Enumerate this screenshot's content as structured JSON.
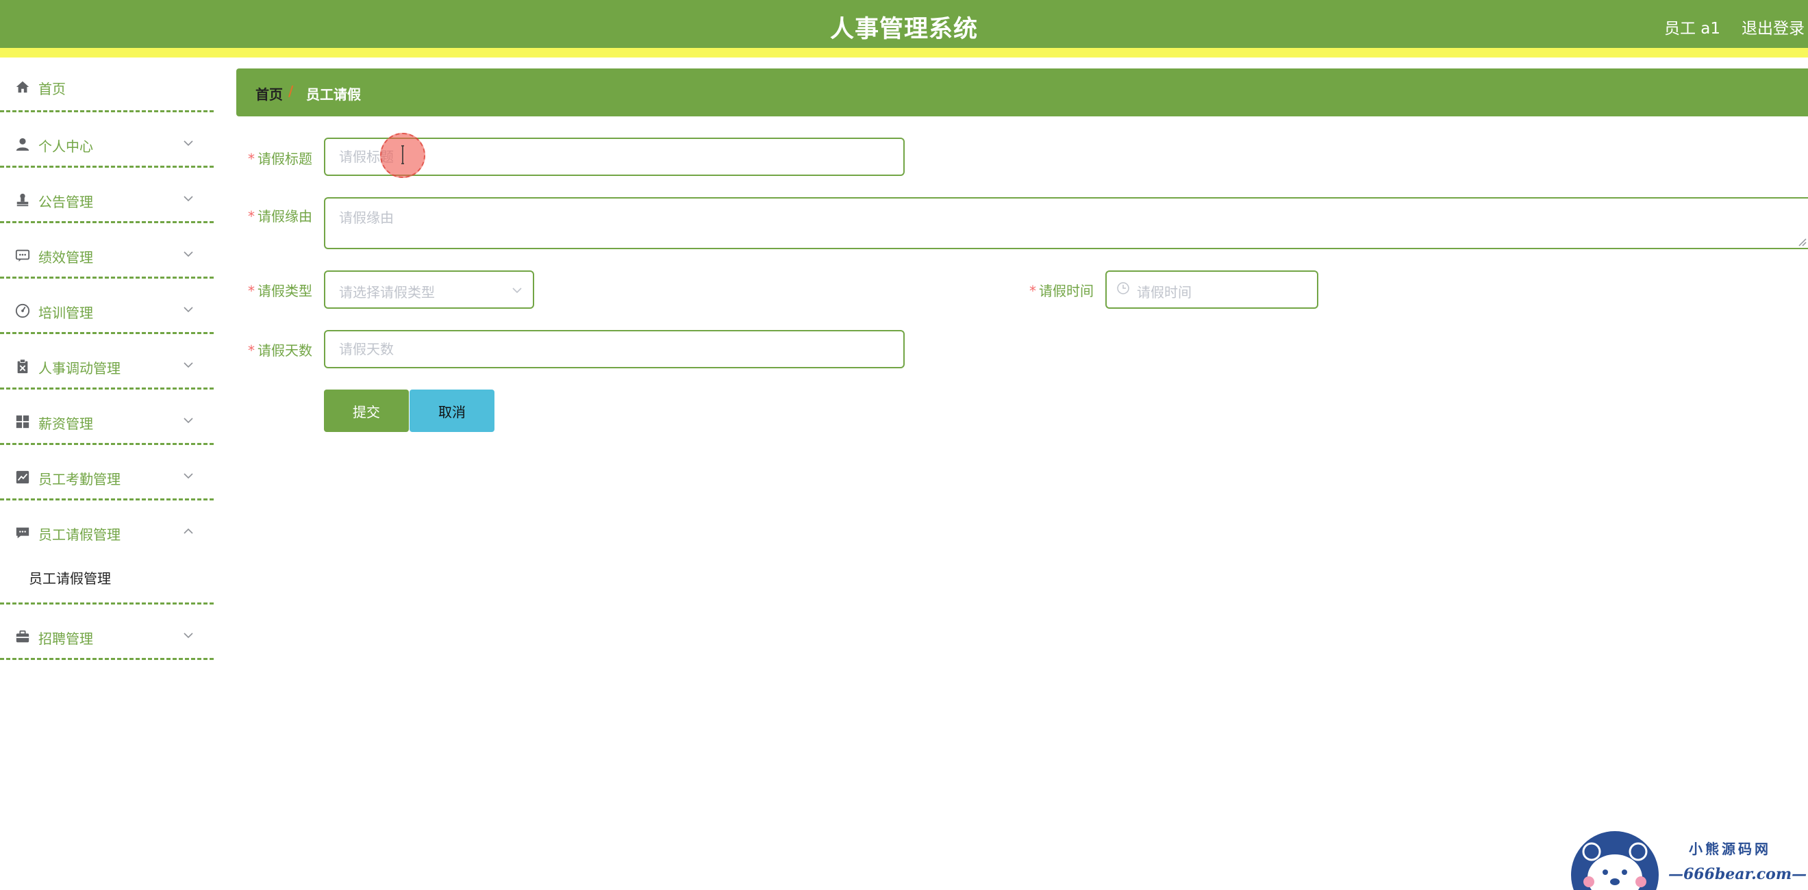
{
  "header": {
    "title": "人事管理系统",
    "user": "员工 a1",
    "logout": "退出登录"
  },
  "colors": {
    "primary": "#72a545",
    "header_stripe": "#f7f75a",
    "cancel_button": "#4fbedb",
    "required_mark": "#f56c6c"
  },
  "sidebar": {
    "items": [
      {
        "label": "首页",
        "icon": "home-icon"
      },
      {
        "label": "个人中心",
        "icon": "user-icon"
      },
      {
        "label": "公告管理",
        "icon": "stamp-icon"
      },
      {
        "label": "绩效管理",
        "icon": "chat-dots-icon"
      },
      {
        "label": "培训管理",
        "icon": "gauge-icon"
      },
      {
        "label": "人事调动管理",
        "icon": "clipboard-icon"
      },
      {
        "label": "薪资管理",
        "icon": "grid-icon"
      },
      {
        "label": "员工考勤管理",
        "icon": "chart-line-icon"
      },
      {
        "label": "员工请假管理",
        "icon": "message-icon",
        "submenu": [
          "员工请假管理"
        ]
      },
      {
        "label": "招聘管理",
        "icon": "briefcase-icon"
      }
    ]
  },
  "breadcrumb": {
    "home": "首页",
    "separator": "/",
    "current": "员工请假"
  },
  "form": {
    "title": {
      "label": "请假标题",
      "placeholder": "请假标题",
      "value": ""
    },
    "reason": {
      "label": "请假缘由",
      "placeholder": "请假缘由",
      "value": ""
    },
    "type": {
      "label": "请假类型",
      "placeholder": "请选择请假类型"
    },
    "time": {
      "label": "请假时间",
      "placeholder": "请假时间"
    },
    "days": {
      "label": "请假天数",
      "placeholder": "请假天数",
      "value": ""
    },
    "required_mark": "*"
  },
  "buttons": {
    "submit": "提交",
    "cancel": "取消"
  },
  "watermark": {
    "top": "小熊源码网",
    "bottom": "—666bear.com—"
  }
}
